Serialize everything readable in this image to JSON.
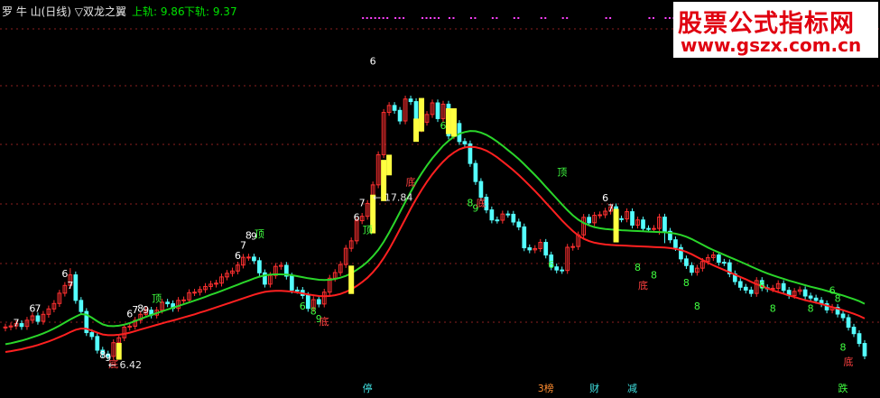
{
  "header": {
    "title": "罗 牛 山(日线) ▽双龙之翼",
    "upper_label": "上轨: 9.86",
    "lower_label": "下轨: 9.37"
  },
  "watermark": {
    "title": "股票公式指标网",
    "url": "www.gszx.com.cn"
  },
  "colors": {
    "background": "#000000",
    "grid": "#8b2020",
    "up_candle": "#ff3030",
    "down_candle": "#54ffff",
    "band_upper": "#2ad52a",
    "band_lower": "#ff2020",
    "signal": "#ffff40",
    "dots": "#ff40ff"
  },
  "chart_data": {
    "type": "candlestick",
    "title": "罗 牛 山(日线) ▽双龙之翼",
    "ylim": [
      5.9,
      19.9
    ],
    "grid": true,
    "price_labels": [
      {
        "text": "17.84",
        "day": 67
      },
      {
        "text": "6.42",
        "day": 18
      }
    ],
    "open": [
      7.88,
      7.92,
      7.96,
      8.05,
      7.94,
      8.18,
      8.35,
      8.14,
      8.41,
      8.62,
      8.83,
      9.23,
      9.53,
      9.94,
      8.95,
      8.52,
      7.7,
      7.55,
      7.02,
      6.87,
      6.78,
      7.31,
      7.5,
      7.91,
      7.95,
      8.18,
      8.41,
      8.57,
      8.38,
      8.57,
      8.88,
      8.82,
      8.64,
      8.95,
      8.97,
      9.25,
      9.27,
      9.37,
      9.49,
      9.58,
      9.62,
      9.86,
      10.0,
      10.09,
      10.32,
      10.62,
      10.63,
      10.49,
      10.02,
      9.58,
      9.92,
      10.27,
      10.31,
      9.89,
      9.35,
      9.34,
      9.14,
      8.64,
      8.98,
      8.81,
      9.27,
      9.81,
      10.03,
      10.34,
      10.97,
      11.26,
      12.04,
      12.21,
      12.71,
      13.43,
      14.6,
      16.24,
      16.51,
      16.32,
      15.91,
      16.76,
      16.66,
      15.6,
      15.86,
      16.16,
      16.61,
      16.0,
      16.56,
      15.33,
      15.81,
      15.11,
      15.02,
      14.26,
      13.56,
      12.95,
      12.46,
      12.07,
      12.06,
      12.3,
      12.29,
      11.99,
      11.8,
      10.99,
      10.91,
      10.96,
      11.2,
      10.71,
      10.25,
      10.13,
      10.11,
      11.01,
      11.04,
      11.49,
      12.17,
      11.96,
      12.25,
      12.27,
      12.41,
      12.58,
      12.12,
      12.11,
      12.39,
      11.87,
      12.07,
      11.74,
      11.73,
      11.74,
      12.18,
      11.63,
      11.3,
      11.0,
      10.56,
      10.3,
      10.04,
      10.2,
      10.46,
      10.61,
      10.71,
      10.43,
      10.41,
      9.98,
      9.68,
      9.46,
      9.35,
      9.22,
      9.72,
      9.44,
      9.4,
      9.42,
      9.6,
      9.34,
      9.14,
      9.3,
      9.36,
      9.12,
      9.04,
      8.95,
      8.82,
      8.58,
      8.68,
      8.42,
      8.28,
      7.91,
      7.66,
      7.28
    ],
    "close": [
      7.92,
      7.96,
      8.05,
      7.94,
      8.18,
      8.35,
      8.14,
      8.41,
      8.62,
      8.83,
      9.23,
      9.53,
      9.94,
      8.95,
      8.52,
      7.7,
      7.55,
      7.02,
      6.87,
      6.78,
      7.31,
      7.5,
      7.91,
      7.95,
      8.18,
      8.41,
      8.57,
      8.38,
      8.57,
      8.88,
      8.82,
      8.64,
      8.95,
      8.97,
      9.25,
      9.27,
      9.37,
      9.49,
      9.58,
      9.62,
      9.86,
      10.0,
      10.09,
      10.32,
      10.62,
      10.63,
      10.49,
      10.02,
      9.58,
      9.92,
      10.27,
      10.31,
      9.89,
      9.35,
      9.34,
      9.14,
      8.64,
      8.98,
      8.81,
      9.27,
      9.81,
      10.03,
      10.34,
      10.97,
      11.26,
      12.04,
      12.21,
      12.71,
      13.43,
      14.6,
      16.24,
      16.51,
      16.32,
      15.91,
      16.76,
      16.66,
      15.6,
      15.86,
      16.16,
      16.61,
      16.0,
      16.56,
      15.33,
      15.81,
      15.11,
      15.02,
      14.26,
      13.56,
      12.95,
      12.46,
      12.07,
      12.06,
      12.3,
      12.29,
      11.99,
      11.8,
      10.99,
      10.91,
      10.96,
      11.2,
      10.71,
      10.25,
      10.13,
      10.11,
      11.01,
      11.04,
      11.49,
      12.17,
      11.96,
      12.25,
      12.27,
      12.41,
      12.58,
      12.12,
      12.11,
      12.39,
      11.87,
      12.07,
      11.74,
      11.73,
      11.74,
      12.18,
      11.63,
      11.3,
      11.0,
      10.56,
      10.3,
      10.04,
      10.2,
      10.46,
      10.61,
      10.71,
      10.43,
      10.41,
      9.98,
      9.68,
      9.46,
      9.35,
      9.22,
      9.72,
      9.44,
      9.4,
      9.42,
      9.6,
      9.34,
      9.14,
      9.3,
      9.36,
      9.12,
      9.04,
      8.95,
      8.82,
      8.58,
      8.68,
      8.42,
      8.28,
      7.91,
      7.66,
      7.28,
      6.8
    ],
    "high": [
      8.05,
      8.09,
      8.18,
      8.18,
      8.31,
      8.48,
      8.48,
      8.54,
      8.75,
      8.96,
      9.36,
      9.66,
      10.2,
      10.07,
      9.08,
      8.65,
      7.83,
      7.68,
      7.15,
      7.0,
      7.44,
      7.63,
      8.04,
      8.08,
      8.31,
      8.54,
      8.7,
      8.7,
      8.7,
      9.01,
      9.01,
      8.95,
      9.08,
      9.1,
      9.38,
      9.4,
      9.5,
      9.62,
      9.71,
      9.75,
      9.99,
      10.13,
      10.22,
      10.45,
      10.75,
      10.76,
      10.76,
      10.62,
      10.15,
      10.05,
      10.4,
      10.44,
      10.44,
      10.02,
      9.48,
      9.47,
      9.27,
      9.11,
      9.11,
      9.4,
      9.94,
      10.16,
      10.47,
      11.1,
      11.39,
      12.17,
      12.34,
      12.84,
      13.56,
      14.73,
      16.37,
      16.64,
      16.64,
      16.45,
      16.89,
      16.89,
      16.79,
      15.99,
      16.29,
      16.74,
      16.74,
      16.69,
      16.69,
      15.94,
      15.94,
      15.24,
      15.15,
      14.39,
      13.69,
      13.08,
      12.59,
      12.2,
      12.43,
      12.43,
      12.42,
      12.12,
      11.93,
      11.12,
      11.09,
      11.33,
      11.33,
      10.84,
      10.38,
      10.26,
      11.14,
      11.17,
      11.62,
      12.3,
      12.3,
      12.38,
      12.4,
      12.54,
      12.71,
      12.71,
      12.24,
      12.52,
      12.52,
      12.2,
      12.2,
      11.86,
      11.87,
      12.31,
      12.31,
      11.76,
      11.43,
      11.13,
      10.69,
      10.43,
      10.33,
      10.59,
      10.74,
      10.84,
      10.84,
      10.56,
      10.54,
      10.11,
      9.81,
      9.59,
      9.48,
      9.85,
      9.85,
      9.57,
      9.55,
      9.73,
      9.73,
      9.47,
      9.43,
      9.49,
      9.49,
      9.25,
      9.17,
      9.08,
      8.95,
      8.81,
      8.81,
      8.55,
      8.41,
      8.04,
      7.79,
      7.41
    ],
    "low": [
      7.75,
      7.79,
      7.83,
      7.81,
      7.81,
      8.05,
      8.01,
      8.01,
      8.28,
      8.49,
      8.7,
      9.1,
      9.4,
      8.82,
      8.39,
      7.57,
      7.42,
      6.89,
      6.74,
      6.65,
      6.65,
      7.18,
      7.37,
      7.78,
      7.82,
      8.05,
      8.28,
      8.25,
      8.25,
      8.44,
      8.69,
      8.51,
      8.51,
      8.82,
      8.84,
      9.12,
      9.14,
      9.24,
      9.36,
      9.45,
      9.49,
      9.73,
      9.87,
      9.96,
      10.19,
      10.49,
      10.36,
      9.89,
      9.45,
      9.45,
      9.79,
      10.14,
      9.76,
      9.22,
      9.21,
      9.01,
      8.51,
      8.51,
      8.68,
      8.68,
      9.14,
      9.68,
      9.9,
      10.21,
      10.84,
      11.13,
      11.91,
      12.08,
      12.58,
      13.3,
      14.47,
      16.11,
      16.19,
      15.78,
      15.78,
      16.53,
      15.47,
      15.47,
      15.73,
      16.03,
      15.87,
      15.87,
      15.2,
      15.2,
      14.98,
      14.89,
      14.13,
      13.43,
      12.82,
      12.33,
      11.94,
      11.93,
      11.93,
      12.16,
      11.86,
      11.67,
      10.86,
      10.78,
      10.78,
      10.83,
      10.58,
      10.12,
      10.0,
      9.98,
      9.98,
      10.88,
      10.91,
      11.36,
      11.83,
      11.83,
      12.12,
      12.14,
      12.28,
      11.99,
      11.98,
      11.98,
      11.74,
      11.74,
      11.61,
      11.6,
      11.6,
      11.5,
      11.17,
      11.17,
      10.87,
      10.43,
      10.17,
      9.91,
      9.91,
      10.07,
      10.33,
      10.48,
      10.3,
      10.28,
      9.85,
      9.55,
      9.33,
      9.22,
      9.09,
      9.09,
      9.31,
      9.27,
      9.27,
      9.29,
      9.21,
      9.01,
      9.01,
      9.17,
      8.99,
      8.91,
      8.82,
      8.69,
      8.45,
      8.45,
      8.29,
      8.15,
      7.78,
      7.53,
      7.15,
      6.67
    ],
    "band_upper": [
      7.25,
      7.29,
      7.34,
      7.39,
      7.45,
      7.52,
      7.59,
      7.67,
      7.76,
      7.86,
      7.97,
      8.09,
      8.21,
      8.32,
      8.42,
      8.4,
      8.28,
      8.14,
      8.02,
      7.96,
      7.95,
      7.97,
      8.01,
      8.07,
      8.15,
      8.23,
      8.31,
      8.39,
      8.46,
      8.53,
      8.6,
      8.67,
      8.73,
      8.8,
      8.87,
      8.94,
      9.01,
      9.09,
      9.17,
      9.24,
      9.32,
      9.4,
      9.48,
      9.56,
      9.64,
      9.72,
      9.8,
      9.87,
      9.92,
      9.95,
      9.96,
      9.96,
      9.95,
      9.93,
      9.89,
      9.85,
      9.81,
      9.78,
      9.75,
      9.74,
      9.75,
      9.78,
      9.83,
      9.9,
      10.0,
      10.13,
      10.28,
      10.45,
      10.66,
      10.91,
      11.22,
      11.58,
      11.97,
      12.37,
      12.77,
      13.16,
      13.53,
      13.87,
      14.18,
      14.46,
      14.71,
      14.95,
      15.14,
      15.3,
      15.41,
      15.48,
      15.52,
      15.51,
      15.46,
      15.37,
      15.25,
      15.11,
      14.95,
      14.78,
      14.61,
      14.43,
      14.23,
      14.02,
      13.81,
      13.59,
      13.36,
      13.13,
      12.9,
      12.67,
      12.45,
      12.25,
      12.08,
      11.95,
      11.86,
      11.79,
      11.75,
      11.72,
      11.7,
      11.69,
      11.67,
      11.66,
      11.65,
      11.64,
      11.63,
      11.62,
      11.61,
      11.6,
      11.59,
      11.57,
      11.54,
      11.49,
      11.42,
      11.33,
      11.22,
      11.11,
      11.0,
      10.9,
      10.81,
      10.72,
      10.63,
      10.54,
      10.45,
      10.36,
      10.26,
      10.17,
      10.08,
      10.0,
      9.92,
      9.85,
      9.79,
      9.72,
      9.66,
      9.6,
      9.54,
      9.48,
      9.43,
      9.38,
      9.32,
      9.26,
      9.2,
      9.14,
      9.07,
      9.0,
      8.92,
      8.82
    ],
    "band_lower": [
      6.95,
      6.98,
      7.02,
      7.06,
      7.11,
      7.16,
      7.22,
      7.29,
      7.36,
      7.44,
      7.53,
      7.62,
      7.72,
      7.81,
      7.86,
      7.85,
      7.78,
      7.7,
      7.63,
      7.6,
      7.6,
      7.62,
      7.65,
      7.7,
      7.76,
      7.82,
      7.88,
      7.94,
      8.0,
      8.06,
      8.12,
      8.17,
      8.23,
      8.29,
      8.35,
      8.41,
      8.48,
      8.54,
      8.61,
      8.68,
      8.75,
      8.82,
      8.89,
      8.96,
      9.03,
      9.1,
      9.17,
      9.23,
      9.28,
      9.31,
      9.32,
      9.32,
      9.31,
      9.29,
      9.26,
      9.22,
      9.18,
      9.15,
      9.12,
      9.11,
      9.12,
      9.15,
      9.2,
      9.28,
      9.38,
      9.51,
      9.66,
      9.83,
      10.04,
      10.29,
      10.59,
      10.93,
      11.31,
      11.71,
      12.11,
      12.51,
      12.88,
      13.23,
      13.55,
      13.84,
      14.1,
      14.33,
      14.53,
      14.69,
      14.81,
      14.88,
      14.91,
      14.89,
      14.84,
      14.76,
      14.64,
      14.5,
      14.34,
      14.17,
      14.0,
      13.81,
      13.61,
      13.4,
      13.19,
      12.97,
      12.74,
      12.51,
      12.28,
      12.05,
      11.84,
      11.64,
      11.47,
      11.34,
      11.25,
      11.19,
      11.15,
      11.12,
      11.1,
      11.09,
      11.08,
      11.07,
      11.06,
      11.05,
      11.04,
      11.03,
      11.02,
      11.01,
      11.0,
      10.98,
      10.95,
      10.9,
      10.83,
      10.74,
      10.63,
      10.52,
      10.41,
      10.31,
      10.22,
      10.13,
      10.04,
      9.95,
      9.86,
      9.77,
      9.67,
      9.58,
      9.5,
      9.42,
      9.34,
      9.27,
      9.21,
      9.14,
      9.08,
      9.02,
      8.96,
      8.91,
      8.86,
      8.81,
      8.75,
      8.69,
      8.63,
      8.57,
      8.5,
      8.43,
      8.35,
      8.25
    ],
    "signal_bars": [
      {
        "day": 21,
        "top": 7.3,
        "bottom": 6.65
      },
      {
        "day": 64,
        "top": 10.3,
        "bottom": 9.2
      },
      {
        "day": 68,
        "top": 13.05,
        "bottom": 11.55
      },
      {
        "day": 70,
        "top": 14.4,
        "bottom": 12.8
      },
      {
        "day": 71,
        "top": 14.6,
        "bottom": 13.8
      },
      {
        "day": 76,
        "top": 16.0,
        "bottom": 15.1
      },
      {
        "day": 77,
        "top": 16.8,
        "bottom": 15.5
      },
      {
        "day": 82,
        "top": 16.4,
        "bottom": 15.4
      },
      {
        "day": 83,
        "top": 16.4,
        "bottom": 15.3
      },
      {
        "day": 113,
        "top": 12.5,
        "bottom": 11.2
      }
    ],
    "dotted_segments": [
      {
        "start": 66,
        "end": 71
      },
      {
        "start": 72,
        "end": 74
      },
      {
        "start": 77,
        "end": 80
      },
      {
        "start": 82,
        "end": 83
      },
      {
        "start": 86,
        "end": 87
      },
      {
        "start": 90,
        "end": 91
      },
      {
        "start": 94,
        "end": 95
      },
      {
        "start": 99,
        "end": 100
      },
      {
        "start": 103,
        "end": 104
      },
      {
        "start": 111,
        "end": 112
      },
      {
        "start": 119,
        "end": 120
      },
      {
        "start": 122,
        "end": 124
      }
    ],
    "candle_labels": [
      {
        "text": "7",
        "day": 2,
        "price": 7.95,
        "color": "#ffffff"
      },
      {
        "text": "6",
        "day": 5,
        "price": 8.5,
        "color": "#ffffff"
      },
      {
        "text": "7",
        "day": 6,
        "price": 8.5,
        "color": "#ffffff"
      },
      {
        "text": "6",
        "day": 11,
        "price": 9.85,
        "color": "#ffffff"
      },
      {
        "text": "7",
        "day": 12,
        "price": 9.4,
        "color": "#ffffff"
      },
      {
        "text": "8",
        "day": 18,
        "price": 6.7,
        "color": "#ffffff"
      },
      {
        "text": "9",
        "day": 19,
        "price": 6.6,
        "color": "#ffffff"
      },
      {
        "text": "底",
        "day": 20,
        "price": 6.35,
        "color": "#ff4040"
      },
      {
        "text": "6",
        "day": 23,
        "price": 8.3,
        "color": "#ffffff"
      },
      {
        "text": "7",
        "day": 24,
        "price": 8.45,
        "color": "#ffffff"
      },
      {
        "text": "8",
        "day": 25,
        "price": 8.5,
        "color": "#ffffff"
      },
      {
        "text": "9",
        "day": 26,
        "price": 8.45,
        "color": "#ffffff"
      },
      {
        "text": "顶",
        "day": 28,
        "price": 8.9,
        "color": "#40ff40"
      },
      {
        "text": "6",
        "day": 43,
        "price": 10.55,
        "color": "#ffffff"
      },
      {
        "text": "7",
        "day": 44,
        "price": 10.95,
        "color": "#ffffff"
      },
      {
        "text": "8",
        "day": 45,
        "price": 11.35,
        "color": "#ffffff"
      },
      {
        "text": "9",
        "day": 46,
        "price": 11.3,
        "color": "#ffffff"
      },
      {
        "text": "顶",
        "day": 47,
        "price": 11.4,
        "color": "#40ff40"
      },
      {
        "text": "6",
        "day": 55,
        "price": 8.6,
        "color": "#40ff40"
      },
      {
        "text": "8",
        "day": 57,
        "price": 8.4,
        "color": "#40ff40"
      },
      {
        "text": "9",
        "day": 58,
        "price": 8.1,
        "color": "#40ff40"
      },
      {
        "text": "底",
        "day": 59,
        "price": 8.0,
        "color": "#ff4040"
      },
      {
        "text": "6",
        "day": 65,
        "price": 12.05,
        "color": "#ffffff"
      },
      {
        "text": "7",
        "day": 66,
        "price": 12.6,
        "color": "#ffffff"
      },
      {
        "text": "顶",
        "day": 67,
        "price": 11.55,
        "color": "#40ff40"
      },
      {
        "text": "6",
        "day": 68,
        "price": 18.1,
        "color": "#ffffff"
      },
      {
        "text": "6",
        "day": 81,
        "price": 15.6,
        "color": "#40ff40"
      },
      {
        "text": "8",
        "day": 86,
        "price": 12.6,
        "color": "#40ff40"
      },
      {
        "text": "9",
        "day": 87,
        "price": 12.4,
        "color": "#40ff40"
      },
      {
        "text": "底",
        "day": 88,
        "price": 12.6,
        "color": "#ff4040"
      },
      {
        "text": "底",
        "day": 75,
        "price": 13.4,
        "color": "#ff4040"
      },
      {
        "text": "6",
        "day": 101,
        "price": 10.2,
        "color": "#40ff40"
      },
      {
        "text": "顶",
        "day": 103,
        "price": 13.8,
        "color": "#40ff40"
      },
      {
        "text": "6",
        "day": 111,
        "price": 12.8,
        "color": "#ffffff"
      },
      {
        "text": "7",
        "day": 112,
        "price": 12.4,
        "color": "#ffffff"
      },
      {
        "text": "8",
        "day": 117,
        "price": 10.1,
        "color": "#40ff40"
      },
      {
        "text": "底",
        "day": 118,
        "price": 9.4,
        "color": "#ff4040"
      },
      {
        "text": "8",
        "day": 120,
        "price": 9.8,
        "color": "#40ff40"
      },
      {
        "text": "8",
        "day": 126,
        "price": 9.5,
        "color": "#40ff40"
      },
      {
        "text": "8",
        "day": 128,
        "price": 8.6,
        "color": "#40ff40"
      },
      {
        "text": "6",
        "day": 140,
        "price": 9.4,
        "color": "#40ff40"
      },
      {
        "text": "8",
        "day": 142,
        "price": 8.5,
        "color": "#40ff40"
      },
      {
        "text": "8",
        "day": 149,
        "price": 8.5,
        "color": "#40ff40"
      },
      {
        "text": "6",
        "day": 153,
        "price": 9.2,
        "color": "#40ff40"
      },
      {
        "text": "8",
        "day": 154,
        "price": 8.9,
        "color": "#40ff40"
      },
      {
        "text": "8",
        "day": 155,
        "price": 7.0,
        "color": "#40ff40"
      },
      {
        "text": "底",
        "day": 156,
        "price": 6.45,
        "color": "#ff4040"
      }
    ],
    "bottom_labels": [
      {
        "text": "停",
        "day": 67,
        "color": "#40e0e0"
      },
      {
        "text": "3榜",
        "day": 100,
        "color": "#ff8c30"
      },
      {
        "text": "财",
        "day": 109,
        "color": "#40e0e0"
      },
      {
        "text": "减",
        "day": 116,
        "color": "#40e0e0"
      },
      {
        "text": "跌",
        "day": 155,
        "color": "#40ff40"
      }
    ]
  }
}
